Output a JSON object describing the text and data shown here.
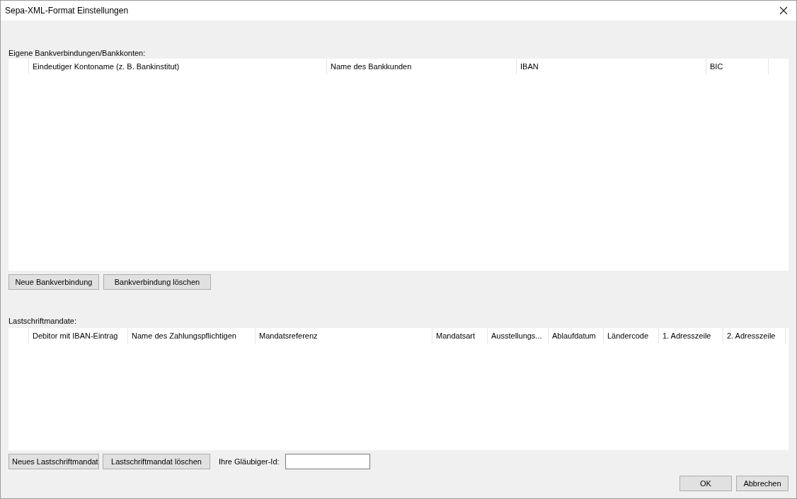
{
  "window": {
    "title": "Sepa-XML-Format Einstellungen"
  },
  "accounts": {
    "label": "Eigene Bankverbindungen/Bankkonten:",
    "columns": [
      "Eindeutiger Kontoname (z. B. Bankinstitut)",
      "Name des Bankkunden",
      "IBAN",
      "BIC"
    ],
    "buttons": [
      "Neue Bankverbindung",
      "Bankverbindung löschen"
    ]
  },
  "mandates": {
    "label": "Lastschriftmandate:",
    "columns": [
      "Debitor mit IBAN-Eintrag",
      "Name des Zahlungspflichtigen",
      "Mandatsreferenz",
      "Mandatsart",
      "Ausstellungs...",
      "Ablaufdatum",
      "Ländercode",
      "1. Adresszeile",
      "2. Adresszeile"
    ],
    "buttons": [
      "Neues Lastschriftmandat",
      "Lastschriftmandat löschen"
    ]
  },
  "creditor_id": {
    "label": "Ihre Gläubiger-Id:"
  },
  "buttons": [
    "OK",
    "Abbrechen"
  ]
}
